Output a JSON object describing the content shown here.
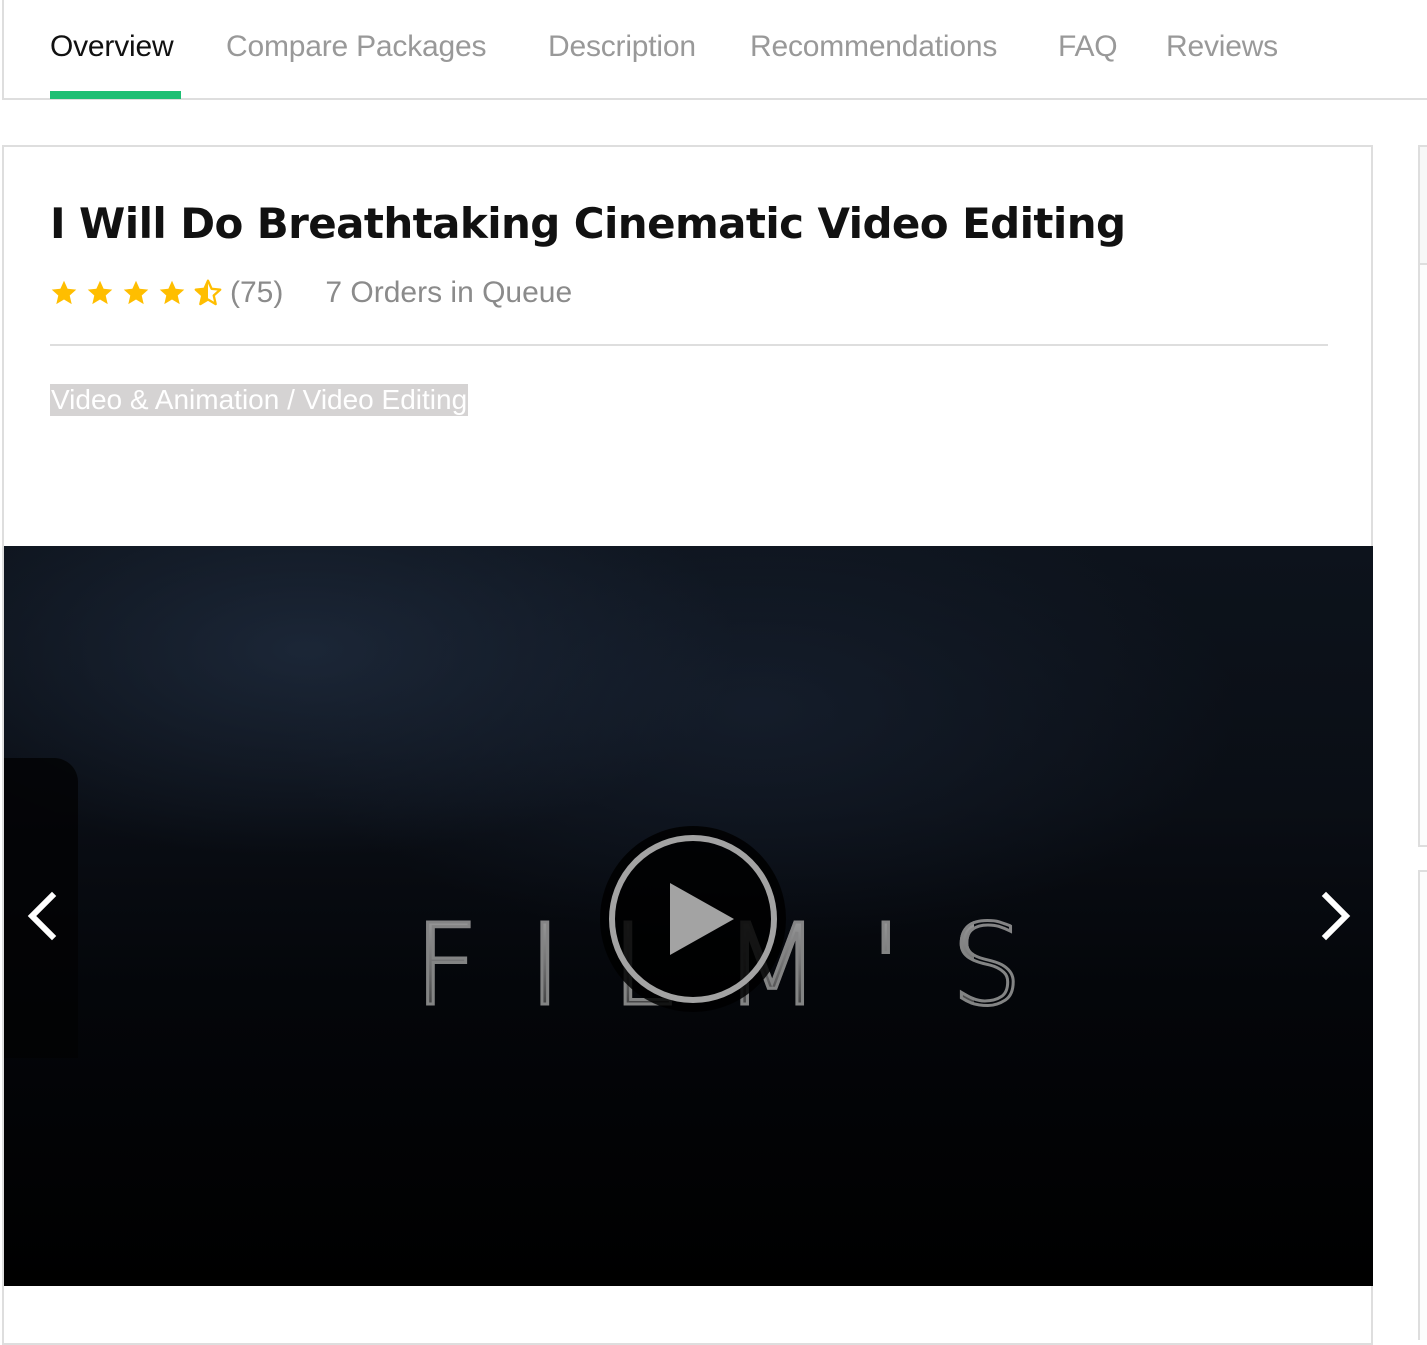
{
  "nav": {
    "tabs": [
      {
        "label": "Overview",
        "active": true
      },
      {
        "label": "Compare Packages",
        "active": false
      },
      {
        "label": "Description",
        "active": false
      },
      {
        "label": "Recommendations",
        "active": false
      },
      {
        "label": "FAQ",
        "active": false
      },
      {
        "label": "Reviews",
        "active": false
      }
    ],
    "active_color": "#1dbf73"
  },
  "gig": {
    "title": "I Will Do Breathtaking Cinematic Video Editing",
    "rating": {
      "value": 4.5,
      "max": 5,
      "review_count": "(75)",
      "star_color": "#ffbe00"
    },
    "queue": "7 Orders in Queue",
    "breadcrumb": "Video & Animation / Video Editing"
  },
  "media": {
    "thumbnail_text": "FILM'S",
    "play_icon": "play-icon",
    "prev_icon": "chevron-left-icon",
    "next_icon": "chevron-right-icon"
  }
}
